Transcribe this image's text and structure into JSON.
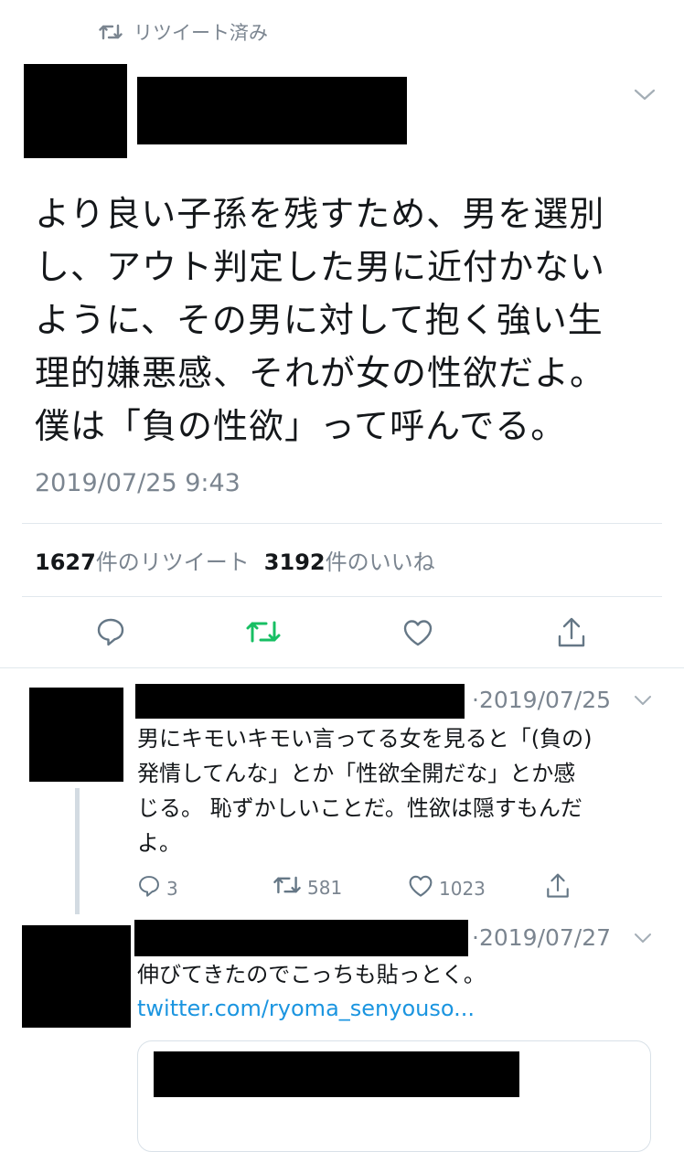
{
  "retweet_header": {
    "label": "リツイート済み",
    "icon": "retweet-icon"
  },
  "main_tweet": {
    "text_lines": [
      "より良い子孫を残すため、男を選別",
      "し、アウト判定した男に近付かない",
      "ように、その男に対して抱く強い生",
      "理的嫌悪感、それが女の性欲だよ。",
      "僕は「負の性欲」って呼んでる。"
    ],
    "timestamp": "2019/07/25 9:43",
    "retweets_count": "1627",
    "retweets_label": "件のリツイート",
    "likes_count": "3192",
    "likes_label": "件のいいね"
  },
  "actions": [
    "reply-icon",
    "retweet-icon",
    "like-icon",
    "share-icon"
  ],
  "replies": [
    {
      "date": "·2019/07/25",
      "text_lines": [
        "男にキモいキモい言ってる女を見ると「(負の)",
        "発情してんな」とか「性欲全開だな」とか感",
        "じる。 恥ずかしいことだ。性欲は隠すもんだ",
        "よ。"
      ],
      "reply_count": "3",
      "retweet_count": "581",
      "like_count": "1023"
    },
    {
      "date": "·2019/07/27",
      "text": "伸びてきたのでこっちも貼っとく。",
      "link": "twitter.com/ryoma_senyouso..."
    }
  ],
  "colors": {
    "retweeted": "#17bf63",
    "link": "#1b95e0",
    "gray": "#7b8590"
  }
}
